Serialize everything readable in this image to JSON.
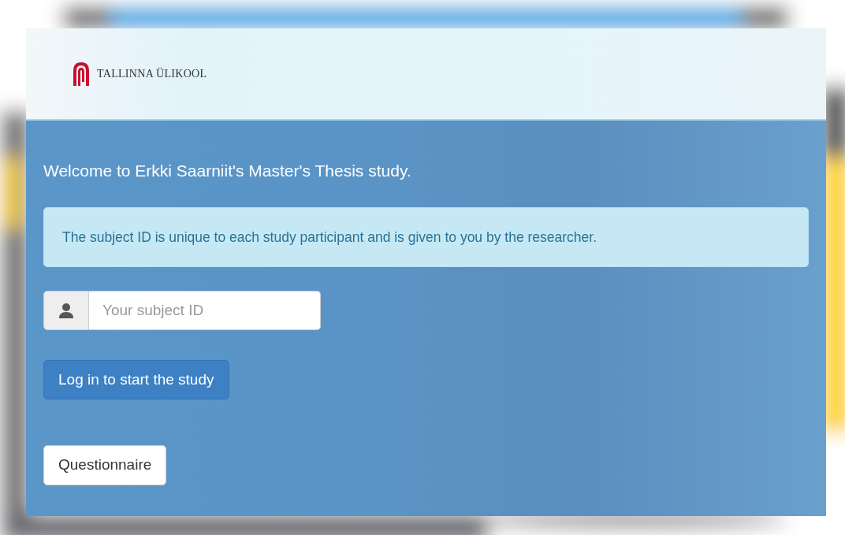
{
  "header": {
    "logo_text": "TALLINNA ÜLIKOOL"
  },
  "welcome": "Welcome to Erkki Saarniit's Master's Thesis study.",
  "info_alert": "The subject ID is unique to each study participant and is given to you by the researcher.",
  "subject_id_field": {
    "placeholder": "Your subject ID"
  },
  "buttons": [
    {
      "label": "Log in to start the study",
      "kind": "primary"
    },
    {
      "label": "Questionnaire",
      "kind": "light"
    }
  ]
}
